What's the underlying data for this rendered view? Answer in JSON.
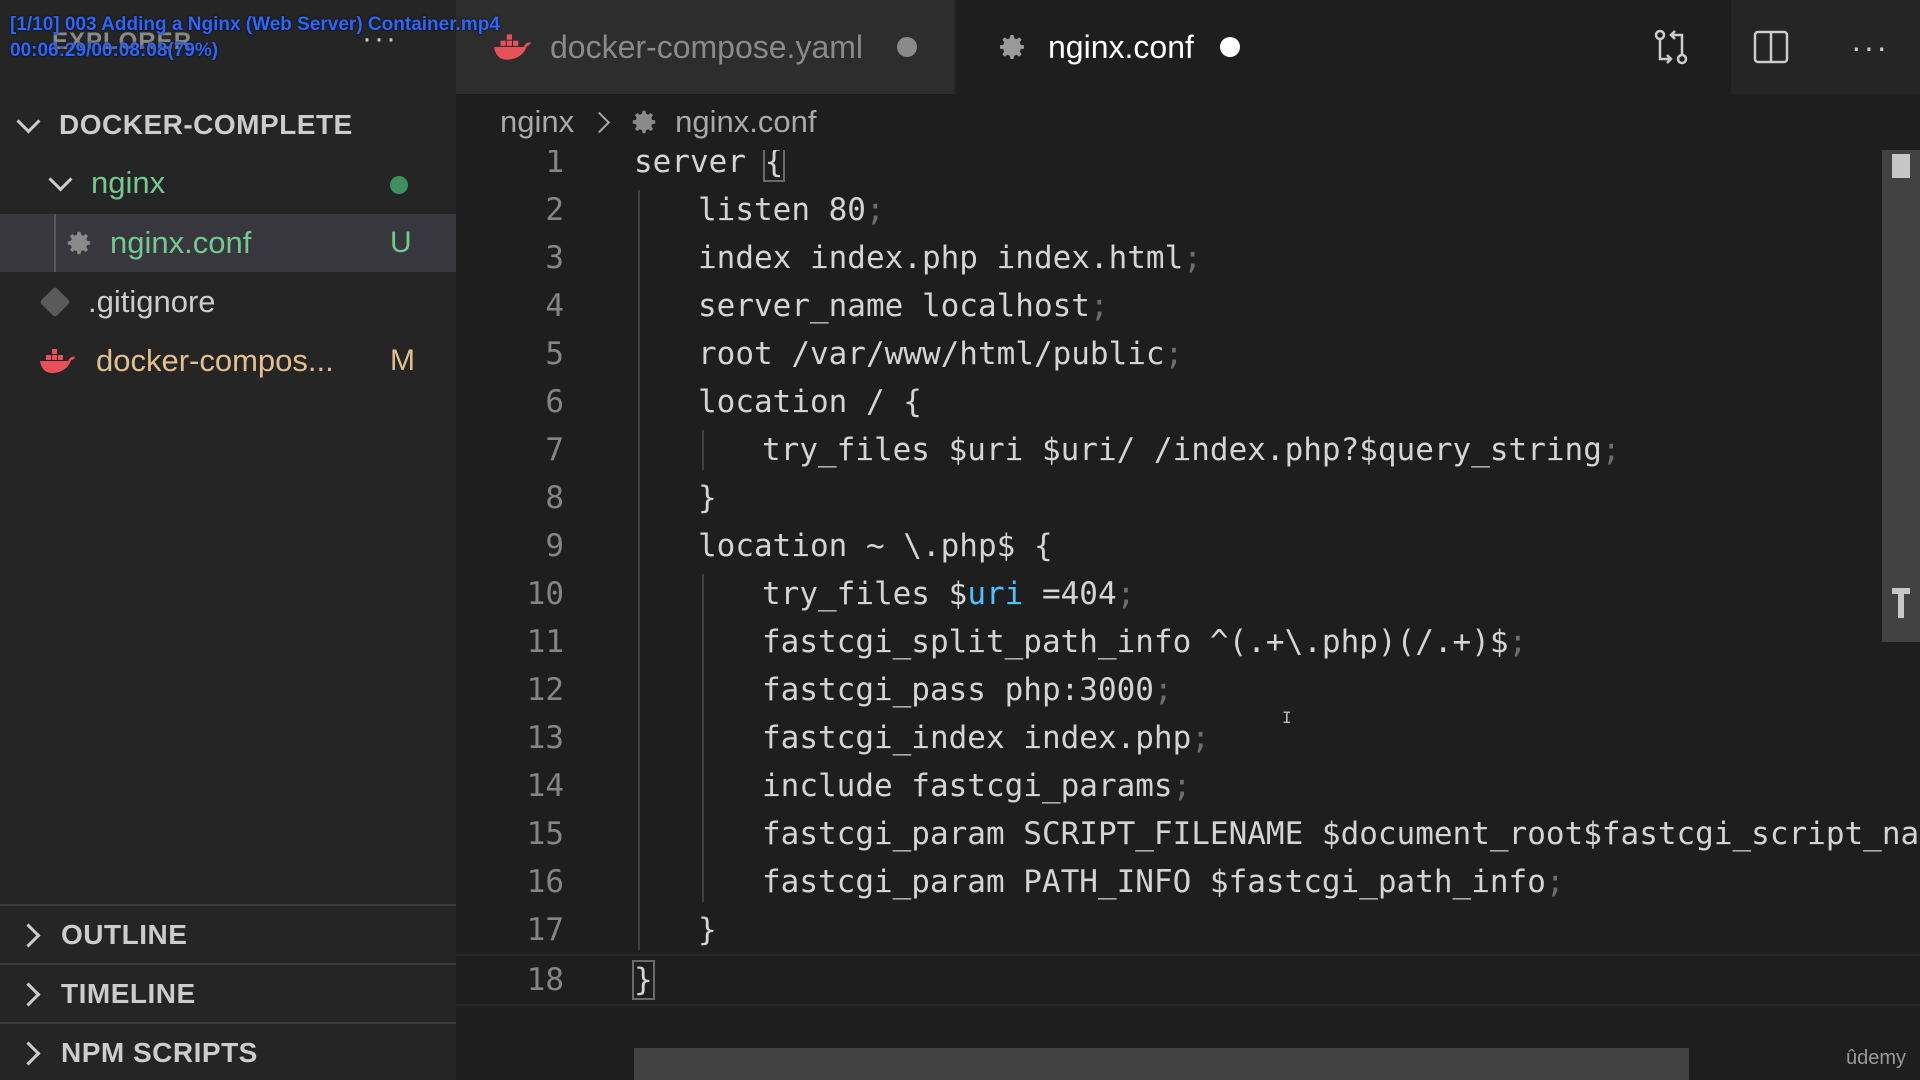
{
  "overlay": {
    "title": "[1/10] 003 Adding a Nginx (Web Server) Container.mp4",
    "progress": "00:06:29/00:08:08(79%)"
  },
  "sidebar": {
    "title": "EXPLORER",
    "more_icon": "ellipsis-icon",
    "root_folder": "DOCKER-COMPLETE",
    "tree": [
      {
        "label": "nginx",
        "status": "",
        "color": "#73c991"
      },
      {
        "label": "nginx.conf",
        "status": "U",
        "color": "#73c991"
      },
      {
        "label": ".gitignore",
        "status": "",
        "color": "#cccccc"
      },
      {
        "label": "docker-compos...",
        "status": "M",
        "color": "#e2c08d"
      }
    ],
    "panels": [
      "OUTLINE",
      "TIMELINE",
      "NPM SCRIPTS"
    ]
  },
  "tabs": [
    {
      "label": "docker-compose.yaml",
      "icon": "docker-whale-icon",
      "active": false,
      "dirty": true
    },
    {
      "label": "nginx.conf",
      "icon": "gear-icon",
      "active": true,
      "dirty": true
    }
  ],
  "tab_actions": [
    "source-control-icon",
    "split-editor-icon",
    "ellipsis-icon"
  ],
  "breadcrumb": {
    "folder": "nginx",
    "file": "nginx.conf"
  },
  "editor": {
    "lines": [
      {
        "num": "1",
        "indent": 0,
        "text": "server {",
        "semi": ""
      },
      {
        "num": "2",
        "indent": 1,
        "text": "listen 80",
        "semi": ";"
      },
      {
        "num": "3",
        "indent": 1,
        "text": "index index.php index.html",
        "semi": ";"
      },
      {
        "num": "4",
        "indent": 1,
        "text": "server_name localhost",
        "semi": ";"
      },
      {
        "num": "5",
        "indent": 1,
        "text": "root /var/www/html/public",
        "semi": ";"
      },
      {
        "num": "6",
        "indent": 1,
        "text": "location / {",
        "semi": ""
      },
      {
        "num": "7",
        "indent": 2,
        "text": "try_files $uri $uri/ /index.php?$query_string",
        "semi": ";"
      },
      {
        "num": "8",
        "indent": 1,
        "text": "}",
        "semi": ""
      },
      {
        "num": "9",
        "indent": 1,
        "text": "location ~ \\.php$ {",
        "semi": ""
      },
      {
        "num": "10",
        "indent": 2,
        "text": "try_files $uri =404",
        "semi": ";"
      },
      {
        "num": "11",
        "indent": 2,
        "text": "fastcgi_split_path_info ^(.+\\.php)(/.+)$",
        "semi": ";"
      },
      {
        "num": "12",
        "indent": 2,
        "text": "fastcgi_pass php:3000",
        "semi": ";"
      },
      {
        "num": "13",
        "indent": 2,
        "text": "fastcgi_index index.php",
        "semi": ";"
      },
      {
        "num": "14",
        "indent": 2,
        "text": "include fastcgi_params",
        "semi": ";"
      },
      {
        "num": "15",
        "indent": 2,
        "text": "fastcgi_param SCRIPT_FILENAME $document_root$fastcgi_script_name",
        "semi": ";"
      },
      {
        "num": "16",
        "indent": 2,
        "text": "fastcgi_param PATH_INFO $fastcgi_path_info",
        "semi": ";"
      },
      {
        "num": "17",
        "indent": 1,
        "text": "}",
        "semi": ""
      },
      {
        "num": "18",
        "indent": 0,
        "text": "}",
        "semi": ""
      }
    ]
  },
  "watermark": "ûdemy",
  "colors": {
    "untracked": "#73c991",
    "modified": "#e2c08d",
    "variable": "#4fc1ff",
    "docker": "#e8515a"
  }
}
